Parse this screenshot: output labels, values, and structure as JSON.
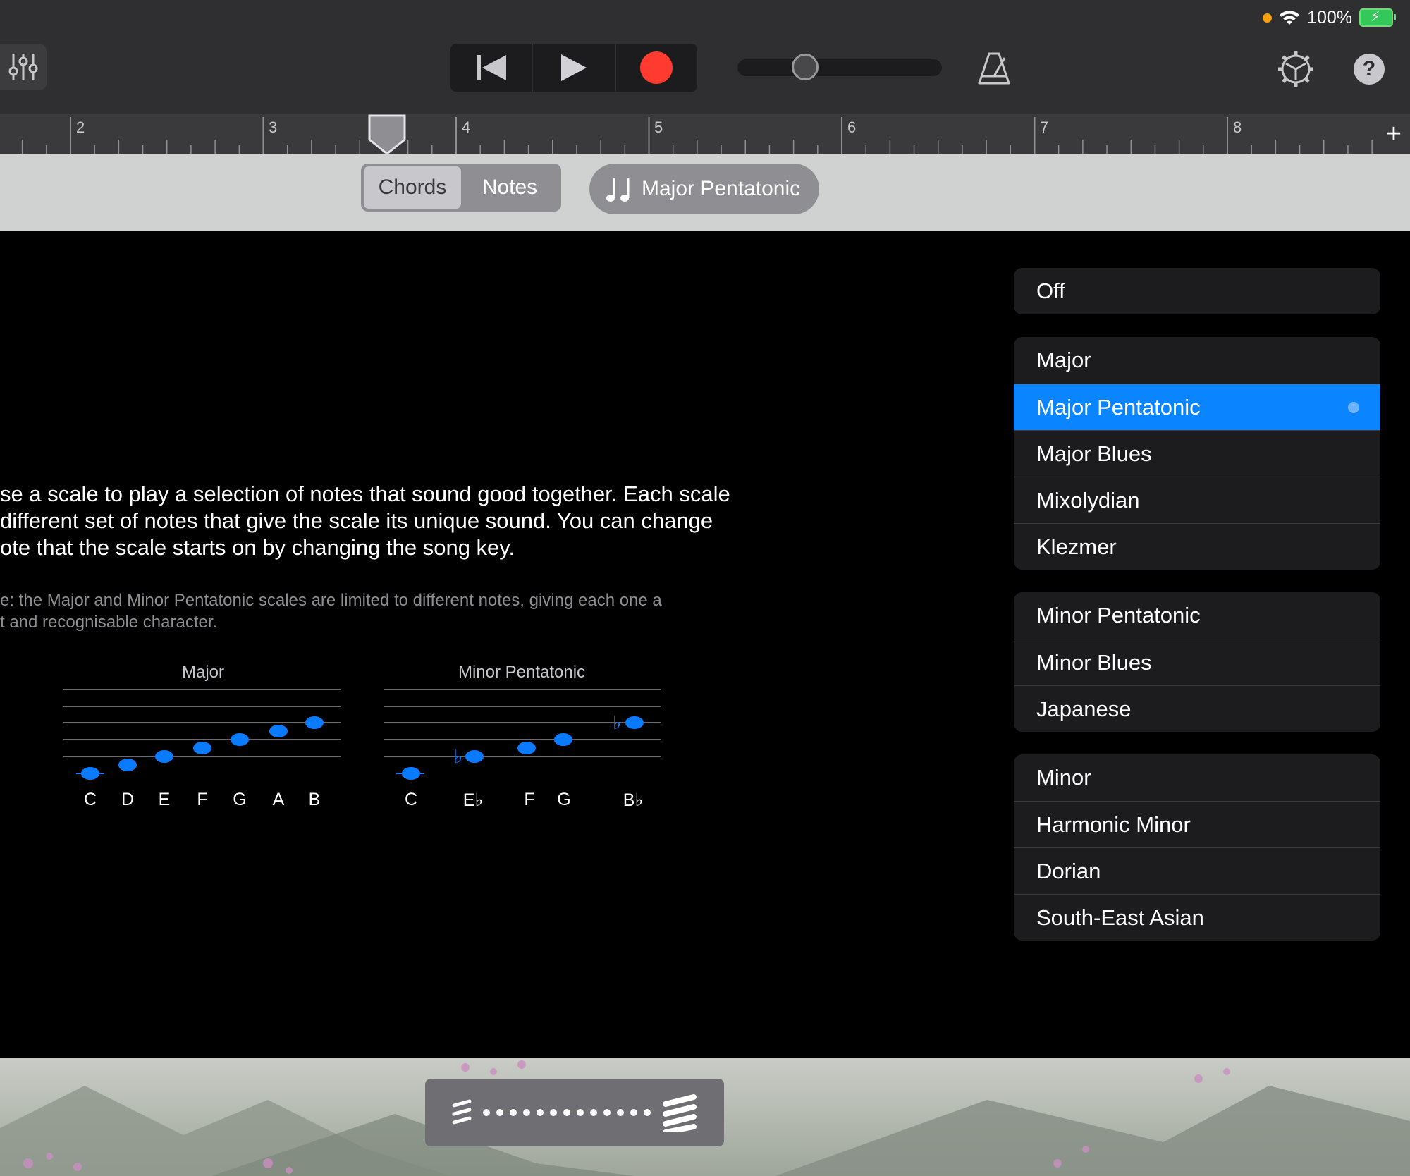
{
  "status_bar": {
    "battery": "100%"
  },
  "ruler": {
    "bars": [
      "2",
      "3",
      "4",
      "5",
      "6",
      "7",
      "8"
    ]
  },
  "mode_toggle": {
    "chords": "Chords",
    "notes": "Notes"
  },
  "scale_button": {
    "label": "Major Pentatonic"
  },
  "description": {
    "lines": [
      "se a scale to play a selection of notes that sound good together. Each scale",
      "different set of notes that give the scale its unique sound. You can change",
      "ote that the scale starts on by changing the song key."
    ],
    "note_lines": [
      "e: the Major and Minor Pentatonic scales are limited to different notes, giving each one a",
      "t and recognisable character."
    ]
  },
  "staffs": [
    {
      "title": "Major",
      "notes": [
        "C",
        "D",
        "E",
        "F",
        "G",
        "A",
        "B"
      ]
    },
    {
      "title": "Minor Pentatonic",
      "notes": [
        "C",
        "E♭",
        "F",
        "G",
        "B♭"
      ]
    }
  ],
  "scale_list": {
    "groups": [
      {
        "items": [
          "Off"
        ]
      },
      {
        "items": [
          "Major",
          "Major Pentatonic",
          "Major Blues",
          "Mixolydian",
          "Klezmer"
        ]
      },
      {
        "items": [
          "Minor Pentatonic",
          "Minor Blues",
          "Japanese"
        ]
      },
      {
        "items": [
          "Minor",
          "Harmonic Minor",
          "Dorian",
          "South-East Asian"
        ]
      }
    ],
    "selected": "Major Pentatonic"
  },
  "colors": {
    "accent": "#0a84ff",
    "record": "#ff3b30",
    "note": "#0a7aff"
  },
  "icons": [
    "mixer-icon",
    "rewind-icon",
    "play-icon",
    "record-icon",
    "metronome-icon",
    "settings-icon",
    "help-icon",
    "plus-icon",
    "notes-icon",
    "strum-left-icon",
    "strum-right-icon"
  ]
}
